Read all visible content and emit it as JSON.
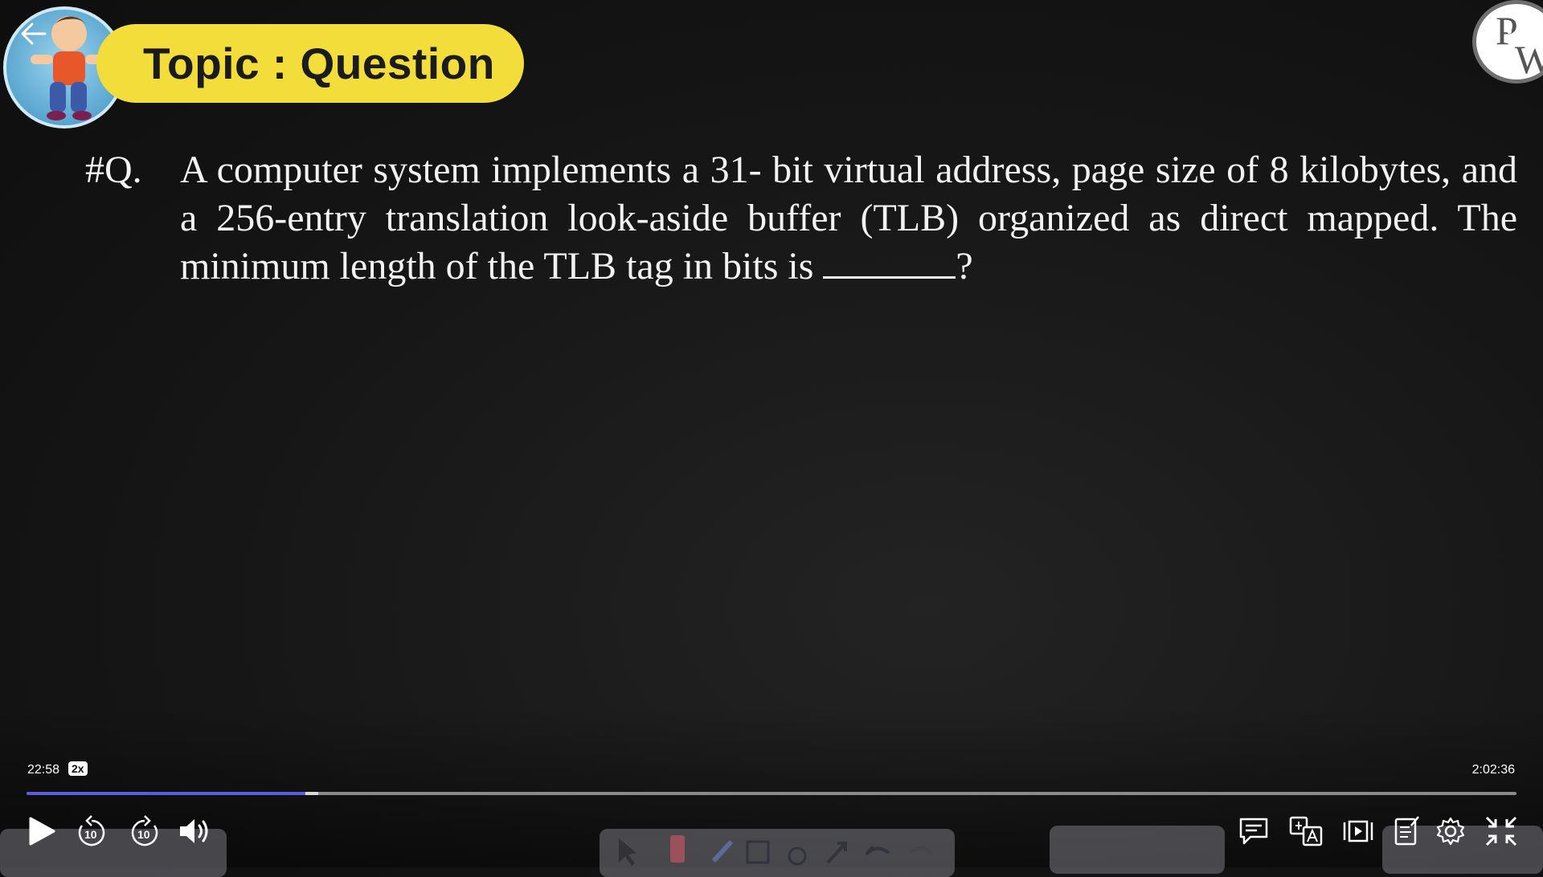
{
  "slide": {
    "topic": "Topic : Question",
    "question_label": "#Q.",
    "question_text": "A computer system implements a 31- bit virtual address, page size of 8 kilobytes, and a 256-entry translation look-aside buffer (TLB) organized as direct mapped. The minimum length of the TLB tag in bits is",
    "question_end": "?",
    "logo_letters": [
      "P",
      "W"
    ]
  },
  "player": {
    "current_time": "22:58",
    "speed": "2x",
    "total_time": "2:02:36",
    "progress_fraction": 0.187,
    "buffered_fraction": 0.196,
    "rewind_label": "10",
    "forward_label": "10"
  },
  "colors": {
    "topic_pill": "#f2dd3a",
    "progress": "#5b5ce0",
    "background": "#161616"
  },
  "icons": [
    "back-arrow-icon",
    "kebab-menu-icon",
    "play-icon",
    "rewind-10-icon",
    "forward-10-icon",
    "volume-icon",
    "chat-icon",
    "translate-icon",
    "playlist-icon",
    "notes-icon",
    "settings-icon",
    "exit-fullscreen-icon"
  ]
}
